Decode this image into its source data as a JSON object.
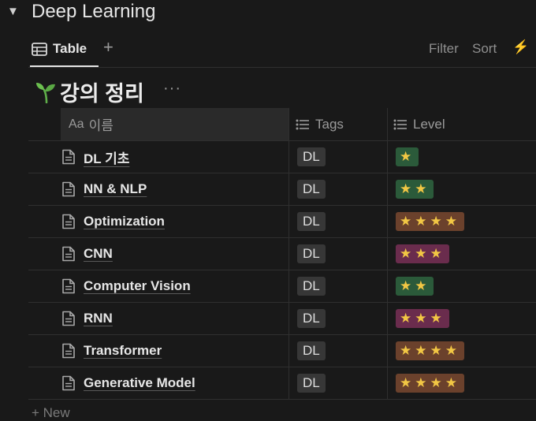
{
  "section": {
    "caret": "▼",
    "title": "Deep Learning"
  },
  "toolbar": {
    "tab_label": "Table",
    "add_view": "+",
    "filter_label": "Filter",
    "sort_label": "Sort",
    "automation_icon": "⚡"
  },
  "database": {
    "icon": "seedling",
    "title": "강의 정리",
    "more": "···"
  },
  "columns": {
    "name_prefix": "Aa",
    "name": "이름",
    "tags": "Tags",
    "level": "Level"
  },
  "rows": [
    {
      "title": "DL 기초",
      "tag": "DL",
      "level": "★",
      "level_color": "#2b5a3a"
    },
    {
      "title": "NN & NLP",
      "tag": "DL",
      "level": "★★",
      "level_color": "#2b5a3a"
    },
    {
      "title": "Optimization",
      "tag": "DL",
      "level": "★★★★",
      "level_color": "#6b412c"
    },
    {
      "title": "CNN",
      "tag": "DL",
      "level": "★★★",
      "level_color": "#6a2c4d"
    },
    {
      "title": "Computer Vision",
      "tag": "DL",
      "level": "★★",
      "level_color": "#2b5a3a"
    },
    {
      "title": "RNN",
      "tag": "DL",
      "level": "★★★",
      "level_color": "#6a2c4d"
    },
    {
      "title": "Transformer",
      "tag": "DL",
      "level": "★★★★",
      "level_color": "#6b412c"
    },
    {
      "title": "Generative Model",
      "tag": "DL",
      "level": "★★★★",
      "level_color": "#6b412c"
    }
  ],
  "footer": {
    "new_label": "+ New"
  }
}
